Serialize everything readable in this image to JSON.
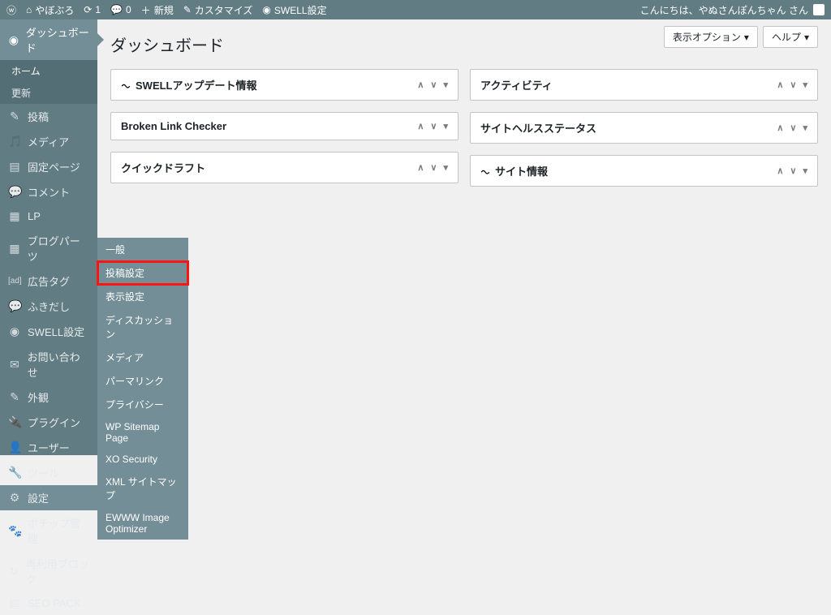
{
  "adminbar": {
    "site_name": "やぼぶろ",
    "updates": "1",
    "comments": "0",
    "new": "新規",
    "customize": "カスタマイズ",
    "swell": "SWELL設定",
    "greeting": "こんにちは、やぬさんぽんちゃん さん"
  },
  "sidebar": {
    "dashboard": "ダッシュボード",
    "home": "ホーム",
    "updates": "更新",
    "posts": "投稿",
    "media": "メディア",
    "pages": "固定ページ",
    "comments": "コメント",
    "lp": "LP",
    "blog_parts": "ブログパーツ",
    "ad_tag": "広告タグ",
    "fukidashi": "ふきだし",
    "swell": "SWELL設定",
    "contact": "お問い合わせ",
    "appearance": "外観",
    "plugins": "プラグイン",
    "users": "ユーザー",
    "tools": "ツール",
    "settings": "設定",
    "pochipp": "ポチップ管理",
    "reusable": "再利用ブロック",
    "seopack": "SEO PACK"
  },
  "flyout": {
    "general": "一般",
    "writing": "投稿設定",
    "reading": "表示設定",
    "discussion": "ディスカッション",
    "media": "メディア",
    "permalink": "パーマリンク",
    "privacy": "プライバシー",
    "sitemap": "WP Sitemap Page",
    "xo": "XO Security",
    "xml": "XML サイトマップ",
    "ewww": "EWWW Image Optimizer"
  },
  "page": {
    "title": "ダッシュボード",
    "screen_options": "表示オプション",
    "help": "ヘルプ"
  },
  "widgets": {
    "swell_update": "SWELLアップデート情報",
    "blc": "Broken Link Checker",
    "quick_draft": "クイックドラフト",
    "activity": "アクティビティ",
    "site_health": "サイトヘルスステータス",
    "site_info": "サイト情報"
  }
}
